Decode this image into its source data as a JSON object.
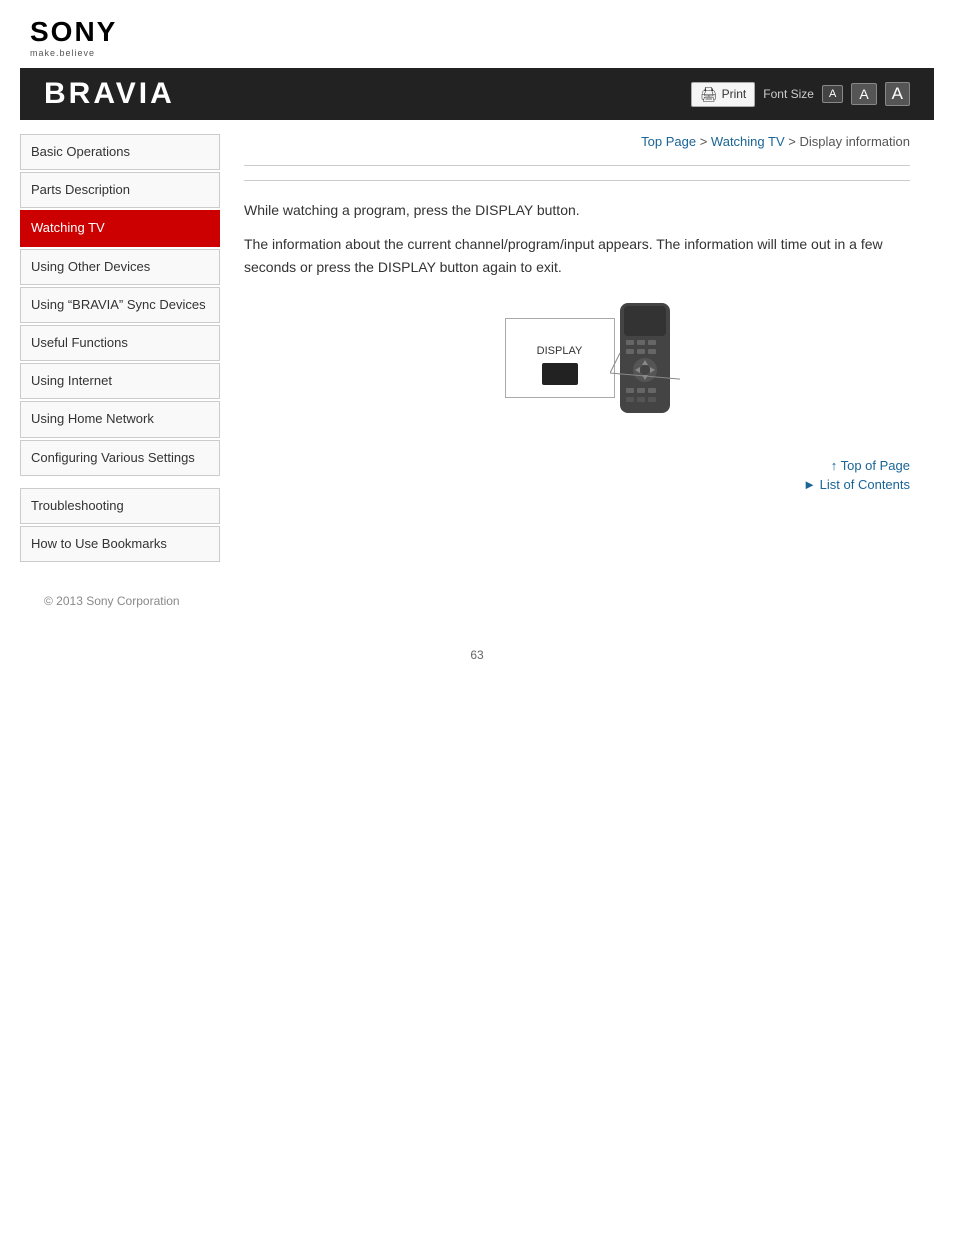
{
  "logo": {
    "brand": "SONY",
    "tagline": "make.believe"
  },
  "banner": {
    "title": "BRAVIA",
    "print_label": "Print",
    "font_size_label": "Font Size",
    "font_a_small": "A",
    "font_a_medium": "A",
    "font_a_large": "A"
  },
  "breadcrumb": {
    "top_page": "Top Page",
    "separator1": " > ",
    "watching_tv": "Watching TV",
    "separator2": " > ",
    "current": "Display information"
  },
  "sidebar": {
    "items": [
      {
        "id": "basic-operations",
        "label": "Basic Operations",
        "active": false
      },
      {
        "id": "parts-description",
        "label": "Parts Description",
        "active": false
      },
      {
        "id": "watching-tv",
        "label": "Watching TV",
        "active": true
      },
      {
        "id": "using-other-devices",
        "label": "Using Other Devices",
        "active": false
      },
      {
        "id": "using-bravia-sync",
        "label": "Using “BRAVIA” Sync Devices",
        "active": false
      },
      {
        "id": "useful-functions",
        "label": "Useful Functions",
        "active": false
      },
      {
        "id": "using-internet",
        "label": "Using Internet",
        "active": false
      },
      {
        "id": "using-home-network",
        "label": "Using Home Network",
        "active": false
      },
      {
        "id": "configuring-settings",
        "label": "Configuring Various Settings",
        "active": false
      }
    ],
    "items2": [
      {
        "id": "troubleshooting",
        "label": "Troubleshooting",
        "active": false
      },
      {
        "id": "how-to-use",
        "label": "How to Use Bookmarks",
        "active": false
      }
    ]
  },
  "content": {
    "paragraph1": "While watching a program, press the DISPLAY button.",
    "paragraph2": "The information about the current channel/program/input appears. The information will time out in a few seconds or press the DISPLAY button again to exit.",
    "display_label": "DISPLAY"
  },
  "footer": {
    "top_of_page": "Top of Page",
    "list_of_contents": "List of Contents",
    "arrow_up": "↑",
    "arrow_right": "►"
  },
  "copyright": "© 2013 Sony Corporation",
  "page_number": "63"
}
